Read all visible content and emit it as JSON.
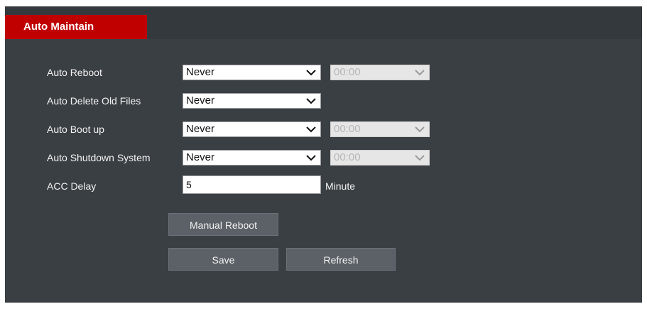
{
  "header": {
    "tab_label": "Auto Maintain"
  },
  "rows": [
    {
      "label": "Auto Reboot",
      "select": "Never",
      "time": "00:00"
    },
    {
      "label": "Auto Delete Old Files",
      "select": "Never"
    },
    {
      "label": "Auto Boot up",
      "select": "Never",
      "time": "00:00"
    },
    {
      "label": "Auto Shutdown System",
      "select": "Never",
      "time": "00:00"
    }
  ],
  "acc": {
    "label": "ACC Delay",
    "value": "5",
    "unit": "Minute"
  },
  "buttons": {
    "manual_reboot": "Manual Reboot",
    "save": "Save",
    "refresh": "Refresh"
  },
  "colors": {
    "panel": "#3a3f44",
    "tab": "#c00000",
    "button": "#5b6166"
  }
}
